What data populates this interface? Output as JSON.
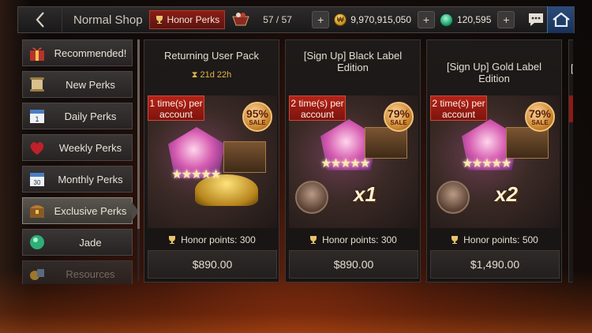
{
  "header": {
    "title": "Normal Shop",
    "active_tab": "Honor Perks",
    "perk_count": "57 / 57",
    "gold_amount": "9,970,915,050",
    "jade_amount": "120,595",
    "icons": [
      "back-chevron-icon",
      "trophy-icon",
      "cart-icon",
      "plus-icon",
      "gold-coin-icon",
      "jade-icon",
      "chat-icon",
      "home-icon"
    ]
  },
  "sidebar": {
    "items": [
      {
        "label": "Recommended!",
        "icon": "gift-icon"
      },
      {
        "label": "New Perks",
        "icon": "scroll-icon"
      },
      {
        "label": "Daily Perks",
        "icon": "calendar-icon"
      },
      {
        "label": "Weekly Perks",
        "icon": "heart-bag-icon"
      },
      {
        "label": "Monthly Perks",
        "icon": "calendar-30-icon"
      },
      {
        "label": "Exclusive Perks",
        "icon": "chest-icon"
      },
      {
        "label": "Jade",
        "icon": "jade-icon"
      },
      {
        "label": "Resources",
        "icon": "resources-icon"
      }
    ],
    "active_index": 5
  },
  "products": [
    {
      "title": "Returning User Pack",
      "timer": "21d 22h",
      "limit": "1 time(s) per account",
      "sale_pct": "95%",
      "sale_label": "SALE",
      "multiplier": "",
      "honor": "Honor points: 300",
      "price": "$890.00"
    },
    {
      "title": "[Sign Up] Black Label Edition",
      "timer": "",
      "limit": "2 time(s) per account",
      "sale_pct": "79%",
      "sale_label": "SALE",
      "multiplier": "x1",
      "honor": "Honor points: 300",
      "price": "$890.00"
    },
    {
      "title": "[Sign Up] Gold Label Edition",
      "timer": "",
      "limit": "2 time(s) per account",
      "sale_pct": "79%",
      "sale_label": "SALE",
      "multiplier": "x2",
      "honor": "Honor points: 500",
      "price": "$1,490.00"
    }
  ],
  "partial_card_title": "["
}
